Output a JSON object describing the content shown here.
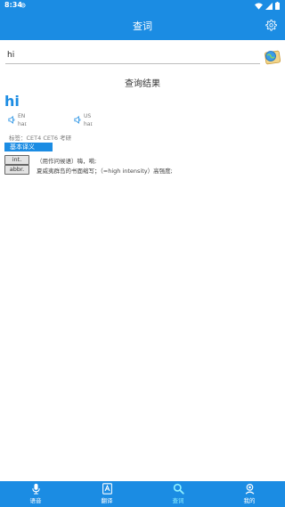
{
  "status": {
    "time": "8:34"
  },
  "header": {
    "title": "查词"
  },
  "search": {
    "value": "hi",
    "placeholder": ""
  },
  "result": {
    "title": "查询结果",
    "word": "hi",
    "pron": [
      {
        "region": "EN",
        "phonetic": "haɪ"
      },
      {
        "region": "US",
        "phonetic": "haɪ"
      }
    ],
    "tags": "标签：CET4   CET6   考研",
    "section_label": "基本译义",
    "definitions": [
      {
        "pos": "int.",
        "text": "（用作问候语）嗨，嗬;"
      },
      {
        "pos": "abbr.",
        "text": "夏威夷群岛的书面缩写；（=high intensity）高强度;"
      }
    ]
  },
  "nav": [
    {
      "label": "语音",
      "icon": "microphone-icon"
    },
    {
      "label": "翻译",
      "icon": "translate-icon"
    },
    {
      "label": "查词",
      "icon": "search-icon"
    },
    {
      "label": "我的",
      "icon": "user-icon"
    }
  ],
  "colors": {
    "primary": "#1b8ce3",
    "active_nav": "#8ff0ff"
  }
}
